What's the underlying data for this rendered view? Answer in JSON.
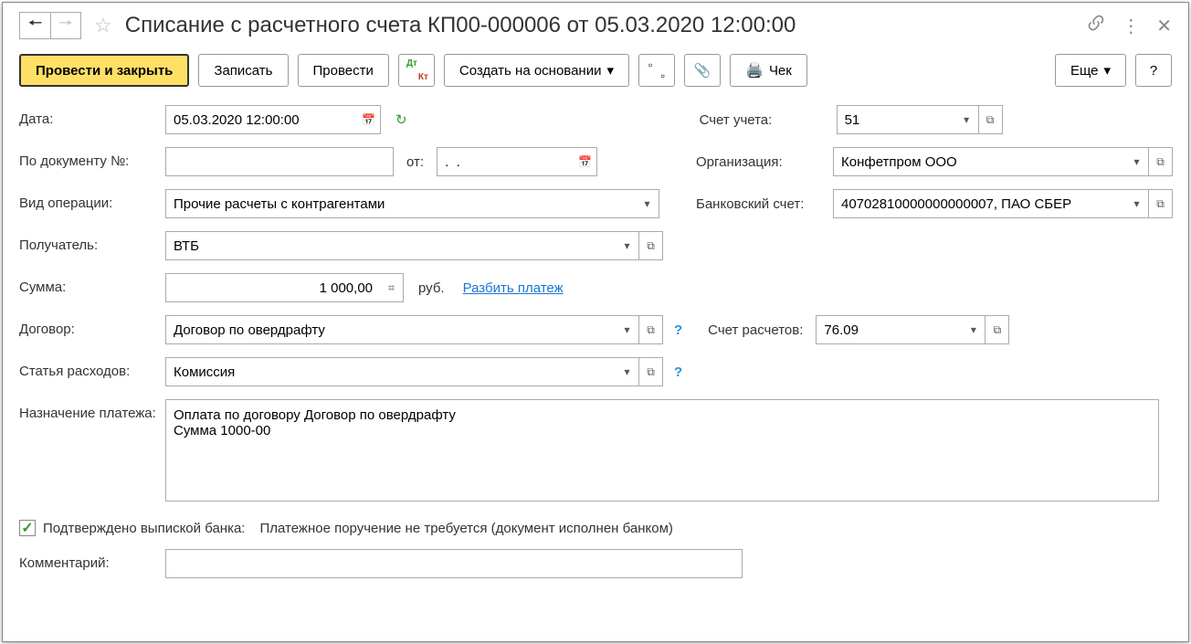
{
  "title": "Списание с расчетного счета КП00-000006 от 05.03.2020 12:00:00",
  "toolbar": {
    "post_close": "Провести и закрыть",
    "save": "Записать",
    "post": "Провести",
    "create_based_on": "Создать на основании",
    "receipt": "Чек",
    "more": "Еще"
  },
  "labels": {
    "date": "Дата:",
    "doc_number": "По документу №:",
    "from": "от:",
    "account": "Счет учета:",
    "organization": "Организация:",
    "operation_type": "Вид операции:",
    "bank_account": "Банковский счет:",
    "recipient": "Получатель:",
    "amount": "Сумма:",
    "currency": "руб.",
    "split_payment": "Разбить платеж",
    "contract": "Договор:",
    "settlement_account": "Счет расчетов:",
    "expense_item": "Статья расходов:",
    "payment_purpose": "Назначение платежа:",
    "confirmed_bank": "Подтверждено выпиской банка:",
    "confirmed_bank_note": "Платежное поручение не требуется (документ исполнен банком)",
    "comment": "Комментарий:"
  },
  "values": {
    "date": "05.03.2020 12:00:00",
    "doc_number": "",
    "doc_date_from": ".  .",
    "account": "51",
    "organization": "Конфетпром ООО",
    "operation_type": "Прочие расчеты с контрагентами",
    "bank_account": "40702810000000000007, ПАО СБЕР",
    "recipient": "ВТБ",
    "amount": "1 000,00",
    "contract": "Договор по овердрафту",
    "settlement_account": "76.09",
    "expense_item": "Комиссия",
    "payment_purpose": "Оплата по договору Договор по овердрафту\nСумма 1000-00",
    "comment": ""
  }
}
